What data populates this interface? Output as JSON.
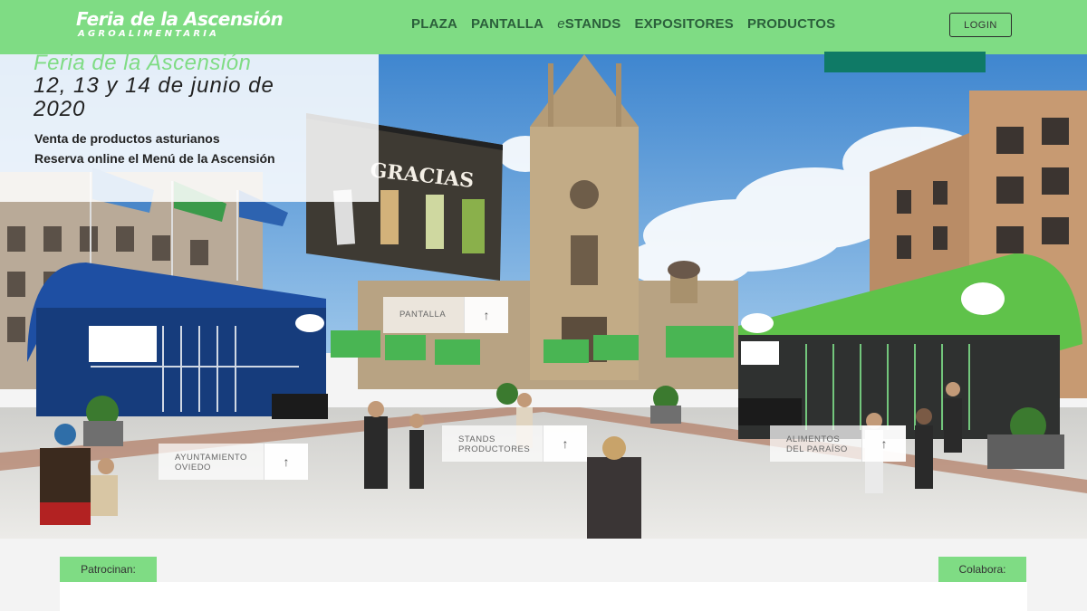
{
  "header": {
    "logo_title": "Feria de la Ascensión",
    "logo_subtitle": "AGROALIMENTARIA",
    "nav": [
      {
        "label": "PLAZA"
      },
      {
        "label": "PANTALLA"
      },
      {
        "prefix": "e",
        "label": "STANDS"
      },
      {
        "label": "EXPOSITORES"
      },
      {
        "label": "PRODUCTOS"
      }
    ],
    "login_label": "LOGIN"
  },
  "info": {
    "event": "Feria de la Ascensión",
    "dates": "12, 13 y 14 de junio de 2020",
    "line1": "Venta de productos asturianos",
    "line2": "Reserva online el Menú de la Ascensión"
  },
  "scene": {
    "billboard_text": "GRACIAS",
    "hotspots": [
      {
        "label": "PANTALLA",
        "icon": "arrow-up-icon"
      },
      {
        "label": "AYUNTAMIENTO OVIEDO",
        "icon": "arrow-up-icon"
      },
      {
        "label": "STANDS PRODUCTORES",
        "icon": "arrow-up-icon"
      },
      {
        "label": "ALIMENTOS DEL PARAÍSO",
        "icon": "arrow-up-icon"
      }
    ]
  },
  "sponsors": {
    "left_label": "Patrocinan:",
    "right_label": "Colabora:"
  },
  "colors": {
    "brand_green": "#7fdc84",
    "nav_text": "#2b5f3b",
    "blue_stand": "#1e4fa3",
    "green_stand": "#5fc24a",
    "sponsor_teal": "#0f7a66"
  }
}
